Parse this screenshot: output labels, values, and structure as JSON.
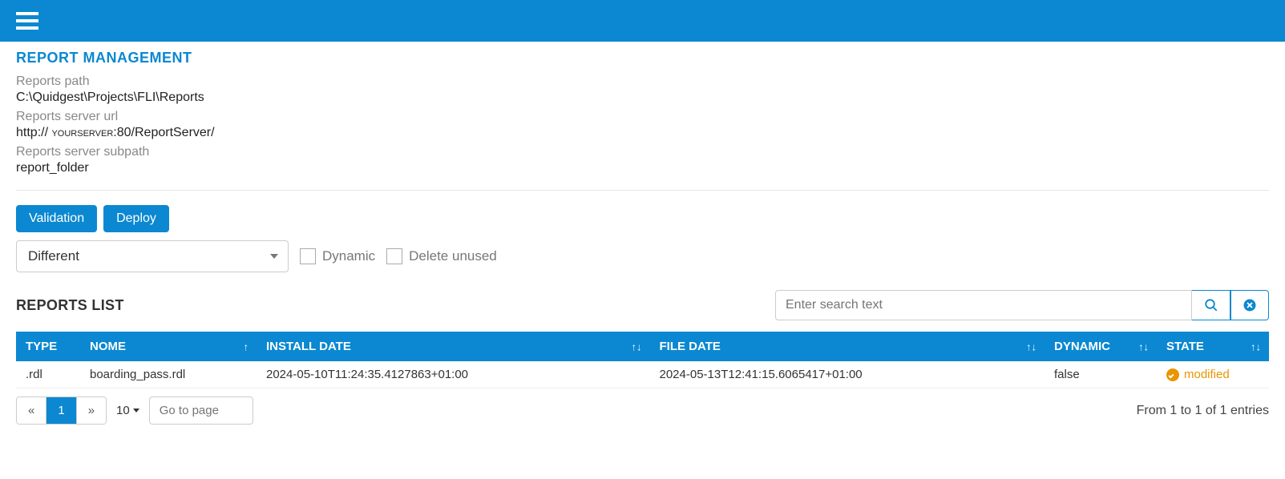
{
  "header": {
    "section_title": "REPORT MANAGEMENT"
  },
  "fields": {
    "path_label": "Reports path",
    "path_value": "C:\\Quidgest\\Projects\\FLI\\Reports",
    "server_label": "Reports server url",
    "server_prefix": "http:// ",
    "server_host": "yourserver",
    "server_suffix": ":80/ReportServer/",
    "subpath_label": "Reports server subpath",
    "subpath_value": "report_folder"
  },
  "buttons": {
    "validation": "Validation",
    "deploy": "Deploy"
  },
  "filter": {
    "selected": "Different",
    "dynamic_label": "Dynamic",
    "delete_label": "Delete unused"
  },
  "list": {
    "title": "REPORTS LIST",
    "search_placeholder": "Enter search text"
  },
  "table": {
    "columns": {
      "type": "TYPE",
      "nome": "NOME",
      "install_date": "INSTALL DATE",
      "file_date": "FILE DATE",
      "dynamic": "DYNAMIC",
      "state": "STATE"
    },
    "rows": [
      {
        "type": ".rdl",
        "nome": "boarding_pass.rdl",
        "install_date": "2024-05-10T11:24:35.4127863+01:00",
        "file_date": "2024-05-13T12:41:15.6065417+01:00",
        "dynamic": "false",
        "state": "modified"
      }
    ]
  },
  "pager": {
    "prev": "«",
    "page": "1",
    "next": "»",
    "size": "10",
    "goto_placeholder": "Go to page",
    "info": "From 1 to 1 of 1 entries"
  }
}
